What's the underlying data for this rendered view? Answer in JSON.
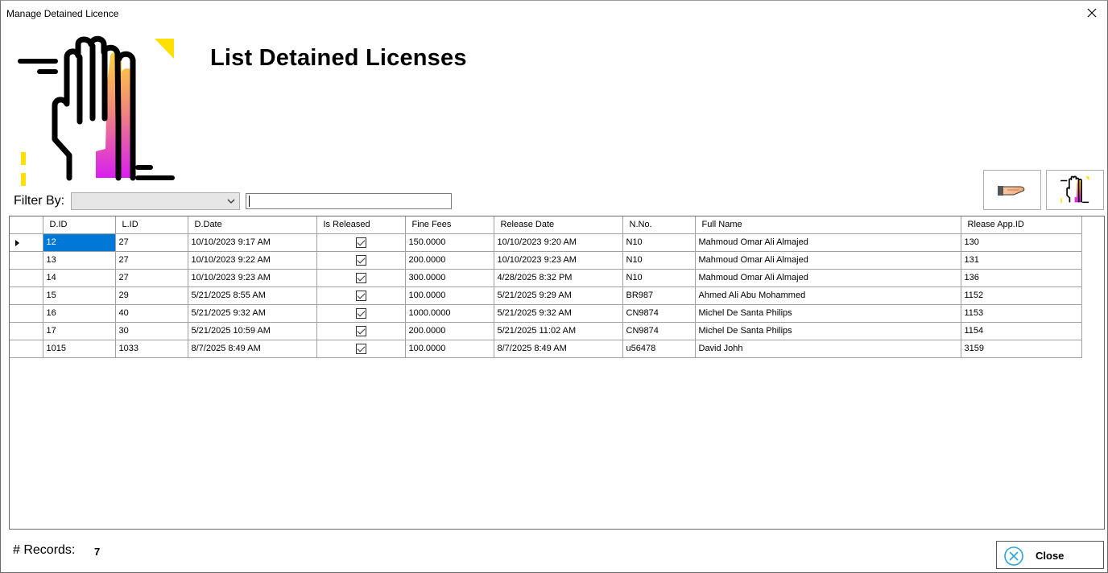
{
  "window": {
    "title": "Manage Detained Licence"
  },
  "header": {
    "title": "List Detained Licenses"
  },
  "filter": {
    "label": "Filter By:",
    "selected": "",
    "text": ""
  },
  "toolbar": {
    "release_icon": "hand-release-icon",
    "detain_icon": "hand-detain-icon"
  },
  "grid": {
    "columns": [
      "D.ID",
      "L.ID",
      "D.Date",
      "Is Released",
      "Fine Fees",
      "Release Date",
      "N.No.",
      "Full Name",
      "Rlease App.ID"
    ],
    "rows": [
      [
        "12",
        "27",
        "10/10/2023 9:17 AM",
        true,
        "150.0000",
        "10/10/2023 9:20 AM",
        "N10",
        "Mahmoud Omar Ali Almajed",
        "130"
      ],
      [
        "13",
        "27",
        "10/10/2023 9:22 AM",
        true,
        "200.0000",
        "10/10/2023 9:23 AM",
        "N10",
        "Mahmoud Omar Ali Almajed",
        "131"
      ],
      [
        "14",
        "27",
        "10/10/2023 9:23 AM",
        true,
        "300.0000",
        "4/28/2025 8:32 PM",
        "N10",
        "Mahmoud Omar Ali Almajed",
        "136"
      ],
      [
        "15",
        "29",
        "5/21/2025 8:55 AM",
        true,
        "100.0000",
        "5/21/2025 9:29 AM",
        "BR987",
        "Ahmed Ali Abu Mohammed",
        "1152"
      ],
      [
        "16",
        "40",
        "5/21/2025 9:32 AM",
        true,
        "1000.0000",
        "5/21/2025 9:32 AM",
        "CN9874",
        "Michel De Santa Philips",
        "1153"
      ],
      [
        "17",
        "30",
        "5/21/2025 10:59 AM",
        true,
        "200.0000",
        "5/21/2025 11:02 AM",
        "CN9874",
        "Michel De Santa Philips",
        "1154"
      ],
      [
        "1015",
        "1033",
        "8/7/2025 8:49 AM",
        true,
        "100.0000",
        "8/7/2025 8:49 AM",
        "u56478",
        "David   Johh",
        "3159"
      ]
    ]
  },
  "footer": {
    "records_label": "# Records:",
    "records_count": "7",
    "close_label": "Close"
  },
  "colors": {
    "selection": "#0078d7",
    "accent_yellow": "#ffe000",
    "gradient_top": "#ffd23c",
    "gradient_bottom": "#d81ef0"
  }
}
